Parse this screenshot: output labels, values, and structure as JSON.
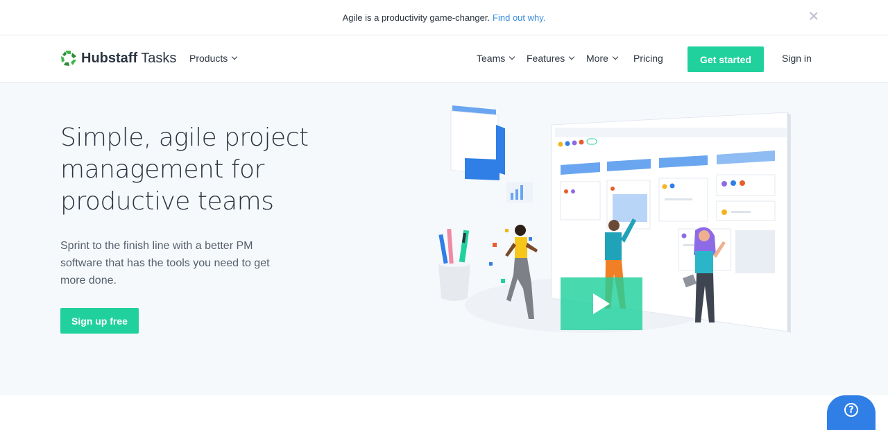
{
  "announcement": {
    "text": "Agile is a productivity game-changer.",
    "link_text": "Find out why."
  },
  "nav": {
    "logo_bold": "Hubstaff",
    "logo_light": " Tasks",
    "products": "Products",
    "teams": "Teams",
    "features": "Features",
    "more": "More",
    "pricing": "Pricing",
    "get_started": "Get started",
    "sign_in": "Sign in"
  },
  "hero": {
    "headline": "Simple, agile project management for productive teams",
    "subtext": "Sprint to the finish line with a better PM software that has the tools you need to get more done.",
    "signup": "Sign up free"
  },
  "help": {
    "icon": "?"
  },
  "colors": {
    "accent": "#20d19d",
    "link": "#3a8de0",
    "help_button": "#2f7fe6",
    "hero_bg": "#f6f9fc"
  }
}
